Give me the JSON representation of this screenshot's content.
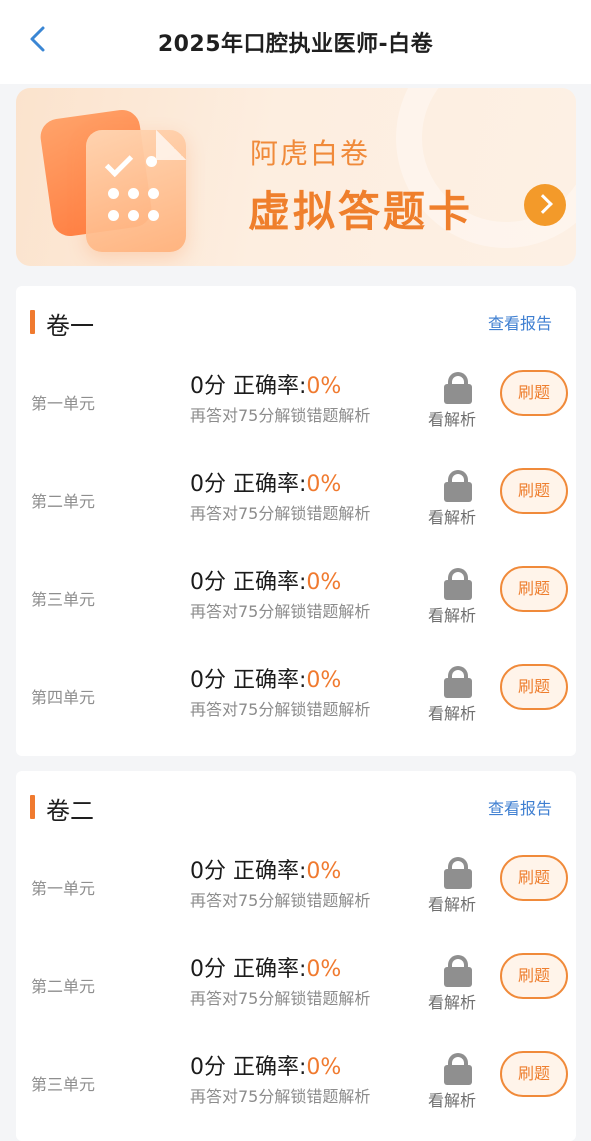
{
  "header": {
    "back_icon": "chevron-left-icon",
    "title": "2025年口腔执业医师-白卷"
  },
  "banner": {
    "subtitle": "阿虎白卷",
    "title": "虚拟答题卡",
    "arrow_icon": "arrow-right-circle-icon",
    "accent_color": "#ef7f2c"
  },
  "sections": [
    {
      "title": "卷一",
      "report_label": "查看报告",
      "units": [
        {
          "name": "第一单元",
          "score": "0分",
          "rate_label": "正确率:",
          "rate_value": "0%",
          "hint": "再答对75分解锁错题解析",
          "analysis_label": "看解析",
          "practice_label": "刷题"
        },
        {
          "name": "第二单元",
          "score": "0分",
          "rate_label": "正确率:",
          "rate_value": "0%",
          "hint": "再答对75分解锁错题解析",
          "analysis_label": "看解析",
          "practice_label": "刷题"
        },
        {
          "name": "第三单元",
          "score": "0分",
          "rate_label": "正确率:",
          "rate_value": "0%",
          "hint": "再答对75分解锁错题解析",
          "analysis_label": "看解析",
          "practice_label": "刷题"
        },
        {
          "name": "第四单元",
          "score": "0分",
          "rate_label": "正确率:",
          "rate_value": "0%",
          "hint": "再答对75分解锁错题解析",
          "analysis_label": "看解析",
          "practice_label": "刷题"
        }
      ]
    },
    {
      "title": "卷二",
      "report_label": "查看报告",
      "units": [
        {
          "name": "第一单元",
          "score": "0分",
          "rate_label": "正确率:",
          "rate_value": "0%",
          "hint": "再答对75分解锁错题解析",
          "analysis_label": "看解析",
          "practice_label": "刷题"
        },
        {
          "name": "第二单元",
          "score": "0分",
          "rate_label": "正确率:",
          "rate_value": "0%",
          "hint": "再答对75分解锁错题解析",
          "analysis_label": "看解析",
          "practice_label": "刷题"
        },
        {
          "name": "第三单元",
          "score": "0分",
          "rate_label": "正确率:",
          "rate_value": "0%",
          "hint": "再答对75分解锁错题解析",
          "analysis_label": "看解析",
          "practice_label": "刷题"
        }
      ]
    }
  ]
}
